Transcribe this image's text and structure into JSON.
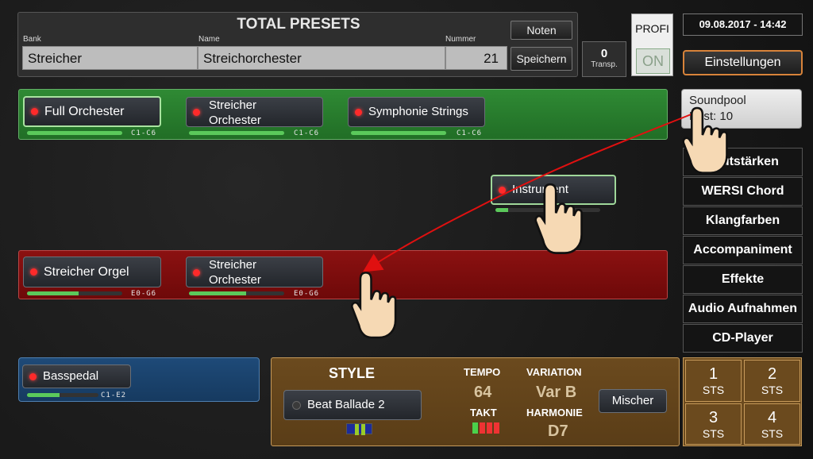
{
  "preset": {
    "title": "TOTAL PRESETS",
    "bank_label": "Bank",
    "name_label": "Name",
    "number_label": "Nummer",
    "bank_value": "Streicher",
    "name_value": "Streichorchester",
    "number_value": "21",
    "noten_label": "Noten",
    "speichern_label": "Speichern"
  },
  "transp": {
    "value": "0",
    "label": "Transp."
  },
  "profi": {
    "label": "PROFI",
    "state": "ON"
  },
  "datetime": "09.08.2017 - 14:42",
  "einstellungen_label": "Einstellungen",
  "soundpool": {
    "line1": "Soundpool",
    "line2": "Best: 10"
  },
  "upper_panel": {
    "color": "#2f8a34",
    "instruments": [
      {
        "label": "Full Orchester",
        "range": "C1-C6",
        "level": 0.72,
        "selected": true
      },
      {
        "label": "Streicher Orchester",
        "range": "C1-C6",
        "level": 0.7,
        "selected": false
      },
      {
        "label": "Symphonie Strings",
        "range": "C1-C6",
        "level": 0.74,
        "selected": false
      }
    ]
  },
  "dragged_instrument": {
    "label": "Instrument",
    "level": 0.12
  },
  "lower_panel": {
    "color": "#8b1111",
    "instruments": [
      {
        "label": "Streicher Orgel",
        "range": "E0-G6",
        "level": 0.54
      },
      {
        "label": "Streicher Orchester",
        "range": "E0-G6",
        "level": 0.6
      }
    ]
  },
  "bass_panel": {
    "color": "#1e4a78",
    "instrument": {
      "label": "Basspedal",
      "range": "C1-E2",
      "level": 0.45
    }
  },
  "side_menu": [
    "Lautstärken",
    "WERSI Chord",
    "Klangfarben",
    "Accompaniment",
    "Effekte",
    "Audio Aufnahmen",
    "CD-Player"
  ],
  "style_panel": {
    "title": "STYLE",
    "button_label": "Beat Ballade 2",
    "tempo_label": "TEMPO",
    "tempo_value": "64",
    "takt_label": "TAKT",
    "variation_label": "VARIATION",
    "variation_value": "Var B",
    "harmonie_label": "HARMONIE",
    "harmonie_value": "D7",
    "mischer_label": "Mischer"
  },
  "sts_buttons": [
    {
      "number": "1",
      "label": "STS"
    },
    {
      "number": "2",
      "label": "STS"
    },
    {
      "number": "3",
      "label": "STS"
    },
    {
      "number": "4",
      "label": "STS"
    }
  ],
  "colors": {
    "accent_orange": "#d8833a",
    "led_red": "#ff2a2a",
    "level_green": "#5bc95b"
  }
}
